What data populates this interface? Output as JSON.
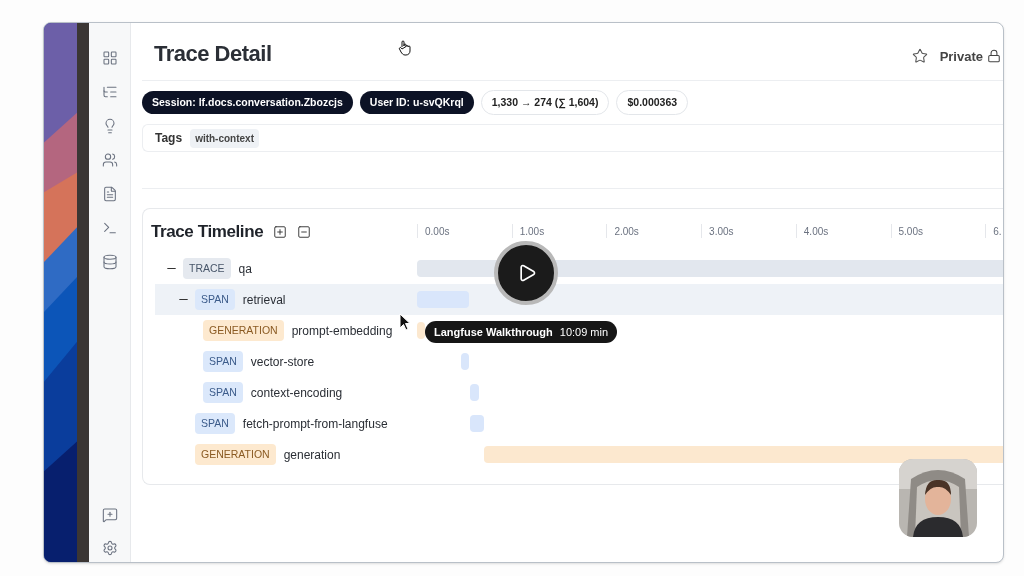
{
  "header": {
    "title": "Trace Detail",
    "visibility": "Private"
  },
  "badges": [
    {
      "text": "Session: lf.docs.conversation.Zbozcjs",
      "kind": "dark"
    },
    {
      "text": "User ID: u-svQKrql",
      "kind": "dark"
    },
    {
      "text": "1,330 → 274 (∑ 1,604)",
      "kind": "outline"
    },
    {
      "text": "$0.000363",
      "kind": "outline"
    }
  ],
  "tags": {
    "label": "Tags",
    "items": [
      "with-context"
    ]
  },
  "timeline": {
    "title": "Trace Timeline",
    "rows": [
      {
        "type": "TRACE",
        "name": "qa",
        "expanded": true,
        "selected": false,
        "children": [
          {
            "type": "SPAN",
            "name": "retrieval",
            "expanded": true,
            "selected": true,
            "children": [
              {
                "type": "GENERATION",
                "name": "prompt-embedding",
                "selected": false
              },
              {
                "type": "SPAN",
                "name": "vector-store",
                "selected": false
              },
              {
                "type": "SPAN",
                "name": "context-encoding",
                "selected": false
              }
            ]
          },
          {
            "type": "SPAN",
            "name": "fetch-prompt-from-langfuse",
            "selected": false
          },
          {
            "type": "GENERATION",
            "name": "generation",
            "selected": false
          }
        ]
      }
    ],
    "ticks": [
      "0.00s",
      "1.00s",
      "2.00s",
      "3.00s",
      "4.00s",
      "5.00s",
      "6."
    ]
  },
  "video": {
    "title": "Langfuse Walkthrough",
    "duration": "10:09 min"
  }
}
